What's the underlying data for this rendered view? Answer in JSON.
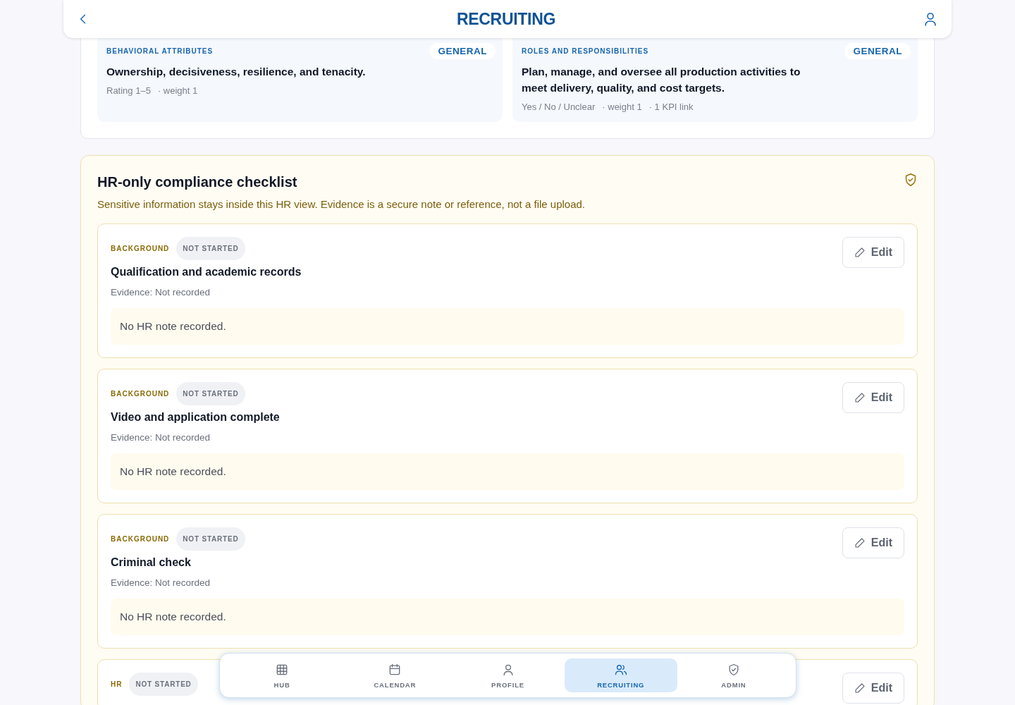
{
  "header": {
    "title": "RECRUITING"
  },
  "criteria": [
    {
      "category": "BEHAVIORAL ATTRIBUTES",
      "tag": "GENERAL",
      "text": "Ownership, decisiveness, resilience, and tenacity.",
      "meta": [
        "Rating 1–5",
        "· weight 1"
      ]
    },
    {
      "category": "ROLES AND RESPONSIBILITIES",
      "tag": "GENERAL",
      "text": "Plan, manage, and oversee all production activities to meet delivery, quality, and cost targets.",
      "meta": [
        "Yes / No / Unclear",
        "· weight 1",
        "· 1 KPI link"
      ]
    }
  ],
  "checklist": {
    "title": "HR-only compliance checklist",
    "subtitle": "Sensitive information stays inside this HR view. Evidence is a secure note or reference, not a file upload.",
    "items": [
      {
        "category": "BACKGROUND",
        "status": "NOT STARTED",
        "title": "Qualification and academic records",
        "evidence": "Evidence: Not recorded",
        "note": "No HR note recorded.",
        "action": "Edit"
      },
      {
        "category": "BACKGROUND",
        "status": "NOT STARTED",
        "title": "Video and application complete",
        "evidence": "Evidence: Not recorded",
        "note": "No HR note recorded.",
        "action": "Edit"
      },
      {
        "category": "BACKGROUND",
        "status": "NOT STARTED",
        "title": "Criminal check",
        "evidence": "Evidence: Not recorded",
        "note": "No HR note recorded.",
        "action": "Edit"
      },
      {
        "category": "HR",
        "status": "NOT STARTED",
        "action": "Edit"
      }
    ]
  },
  "nav": [
    {
      "kind": "grid",
      "label": "HUB",
      "selected": false
    },
    {
      "kind": "calendar",
      "label": "CALENDAR",
      "selected": false
    },
    {
      "kind": "person",
      "label": "PROFILE",
      "selected": false
    },
    {
      "kind": "people",
      "label": "RECRUITING",
      "selected": true
    },
    {
      "kind": "shield",
      "label": "ADMIN",
      "selected": false
    }
  ]
}
